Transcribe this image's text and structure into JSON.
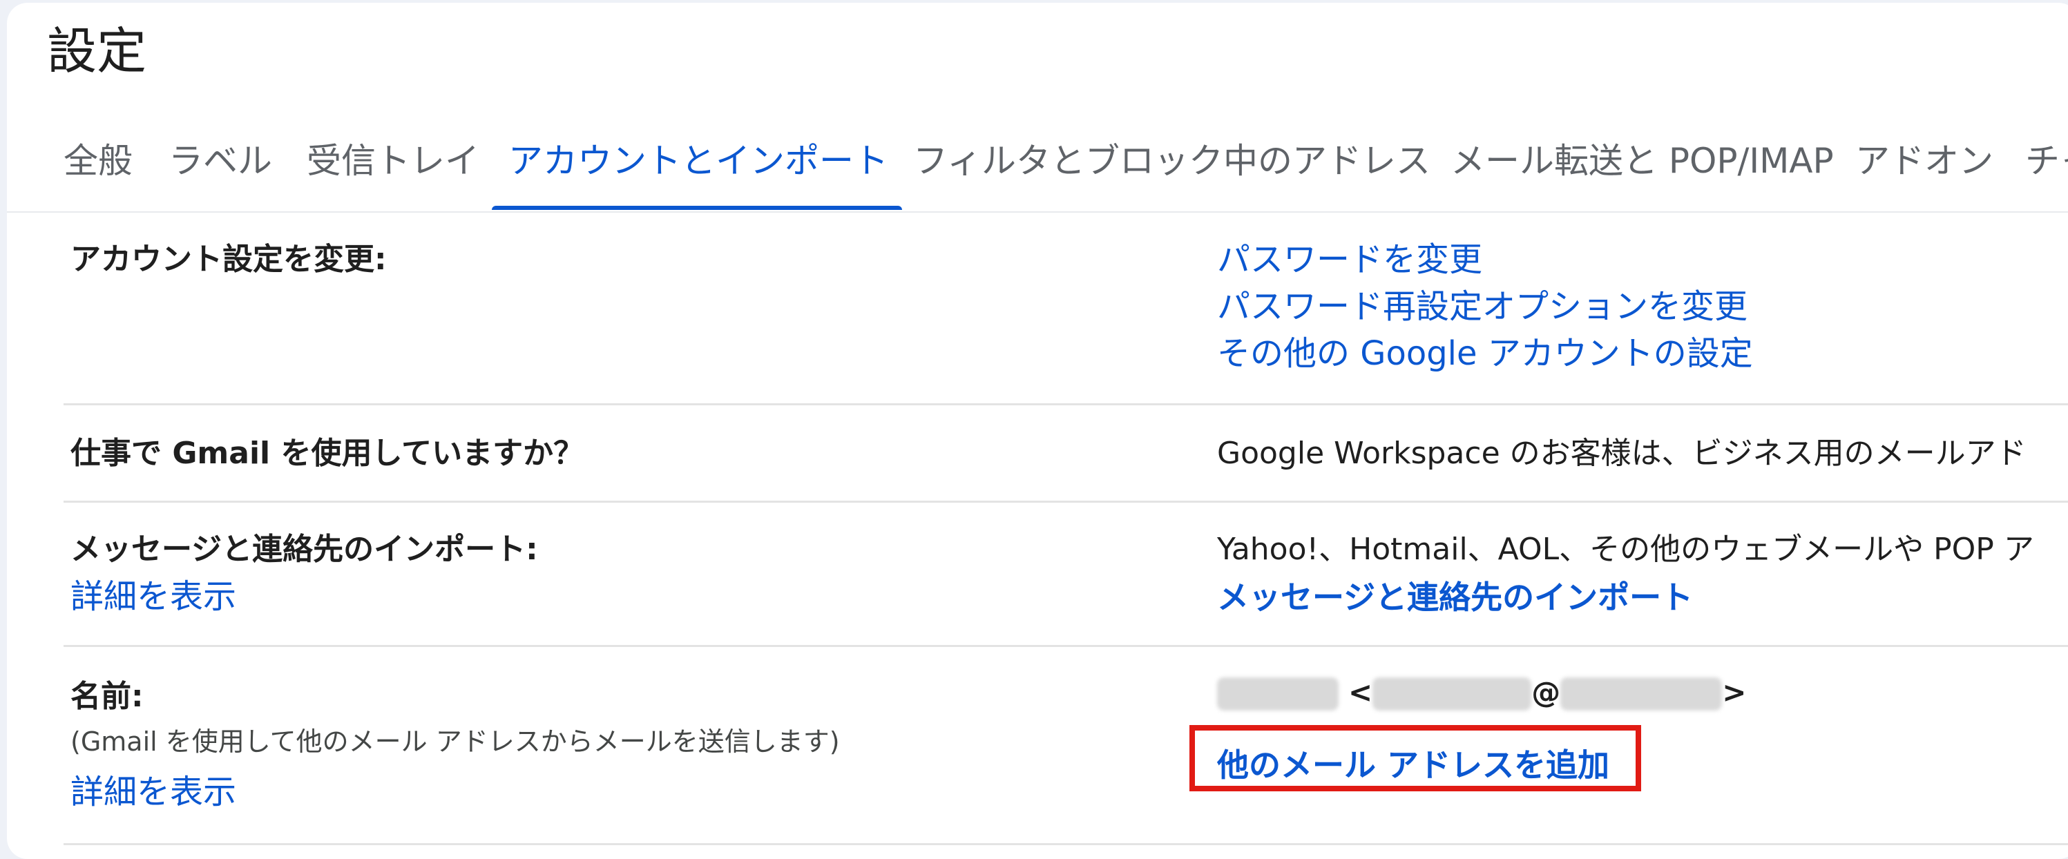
{
  "page": {
    "title": "設定"
  },
  "tabs": [
    {
      "label": "全般"
    },
    {
      "label": "ラベル"
    },
    {
      "label": "受信トレイ"
    },
    {
      "label": "アカウントとインポート",
      "active": true
    },
    {
      "label": "フィルタとブロック中のアドレス"
    },
    {
      "label": "メール転送と POP/IMAP"
    },
    {
      "label": "アドオン"
    },
    {
      "label": "チャ"
    }
  ],
  "rows": {
    "account": {
      "label": "アカウント設定を変更:",
      "links": [
        "パスワードを変更",
        "パスワード再設定オプションを変更",
        "その他の Google アカウントの設定"
      ]
    },
    "work": {
      "label": "仕事で Gmail を使用していますか？",
      "value": "Google Workspace のお客様は、ビジネス用のメールアド"
    },
    "import": {
      "label": "メッセージと連絡先のインポート:",
      "detail": "詳細を表示",
      "value": "Yahoo!、Hotmail、AOL、その他のウェブメールや POP ア",
      "link": "メッセージと連絡先のインポート"
    },
    "name": {
      "label": "名前:",
      "sub": "(Gmail を使用して他のメール アドレスからメールを送信します)",
      "detail": "詳細を表示",
      "addr_open": "<",
      "addr_at": "@",
      "addr_close": ">",
      "link": "他のメール アドレスを追加"
    }
  },
  "colors": {
    "accent": "#0b57d0",
    "highlight": "#e11b14"
  }
}
